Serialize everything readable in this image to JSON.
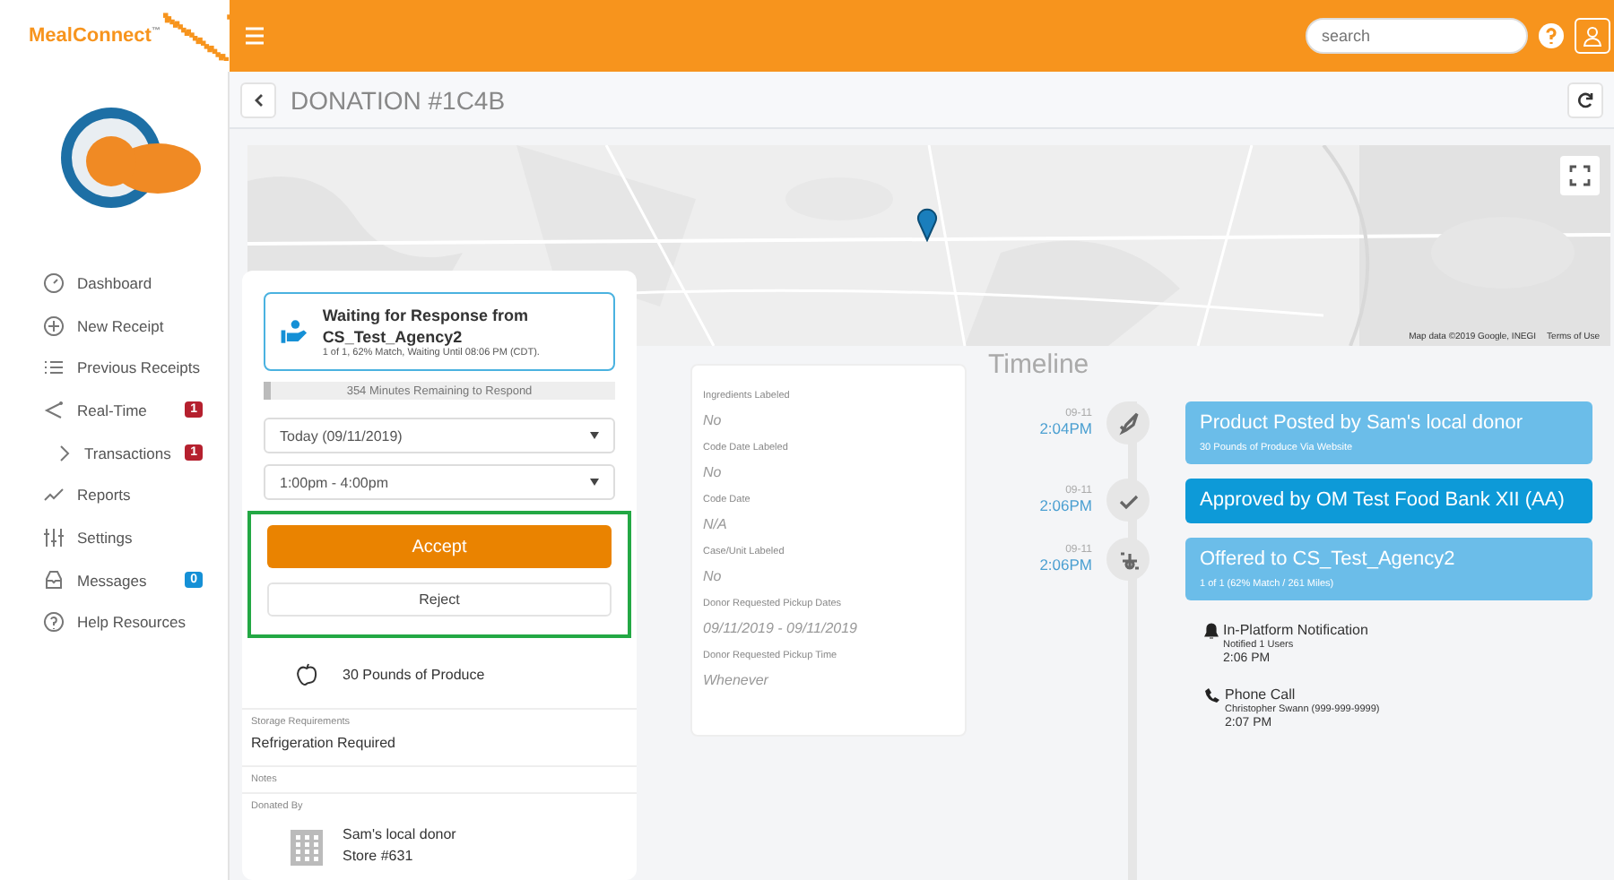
{
  "brand": {
    "name": "MealConnect",
    "trademark": "™"
  },
  "search": {
    "placeholder": "search"
  },
  "sidebar": {
    "items": [
      {
        "label": "Dashboard"
      },
      {
        "label": "New Receipt"
      },
      {
        "label": "Previous Receipts"
      },
      {
        "label": "Real-Time",
        "badge": "1",
        "color": "#b5202e",
        "children": [
          {
            "label": "Transactions",
            "badge": "1",
            "color": "#b5202e"
          }
        ]
      },
      {
        "label": "Reports"
      },
      {
        "label": "Settings"
      },
      {
        "label": "Messages",
        "badge": "0",
        "color": "#1590d6"
      },
      {
        "label": "Help Resources"
      }
    ]
  },
  "page": {
    "title": "DONATION #1C4B"
  },
  "map": {
    "attribution": "Map data ©2019 Google, INEGI",
    "terms": "Terms of Use"
  },
  "offer": {
    "status_title": "Waiting for Response from CS_Test_Agency2",
    "status_detail": "1 of 1, 62% Match, Waiting Until 08:06 PM (CDT).",
    "countdown": "354 Minutes Remaining to Respond",
    "level": 0.02,
    "date_select": "Today (09/11/2019)",
    "time_select": "1:00pm - 4:00pm",
    "accept": "Accept",
    "reject": "Reject",
    "highlighted": true,
    "quantity": "30 Pounds of Produce",
    "fields": [
      {
        "label": "Storage Requirements",
        "value": "Refrigeration Required"
      },
      {
        "label": "Notes"
      },
      {
        "label": "Donated By"
      }
    ],
    "donor": {
      "name": "Sam's local donor",
      "store": "Store #631"
    }
  },
  "details": [
    {
      "label": "Ingredients Labeled",
      "value": "No"
    },
    {
      "label": "Code Date Labeled",
      "value": "No"
    },
    {
      "label": "Code Date",
      "value": "N/A"
    },
    {
      "label": "Case/Unit Labeled",
      "value": "No"
    },
    {
      "label": "Donor Requested Pickup Dates",
      "value": "09/11/2019 - 09/11/2019"
    },
    {
      "label": "Donor Requested Pickup Time",
      "value": "Whenever"
    }
  ],
  "timeline": {
    "title": "Timeline",
    "events": [
      {
        "date": "09-11",
        "time": "2:04PM",
        "title": "Product Posted by Sam's local donor",
        "subtitle": "30 Pounds of Produce Via Website",
        "color": "#6bbde9"
      },
      {
        "date": "09-11",
        "time": "2:06PM",
        "title": "Approved by OM Test Food Bank XII (AA)",
        "color": "#0d9ad8"
      },
      {
        "date": "09-11",
        "time": "2:06PM",
        "title": "Offered to CS_Test_Agency2",
        "subtitle": "1 of 1 (62% Match / 261 Miles)",
        "color": "#6bbde9",
        "notifications": [
          {
            "kind": "bell",
            "title": "In-Platform Notification",
            "detail": "Notified 1 Users",
            "time": "2:06 PM"
          },
          {
            "kind": "phone",
            "title": "Phone Call",
            "detail": "Christopher Swann (999-999-9999)",
            "time": "2:07 PM"
          }
        ]
      }
    ]
  }
}
